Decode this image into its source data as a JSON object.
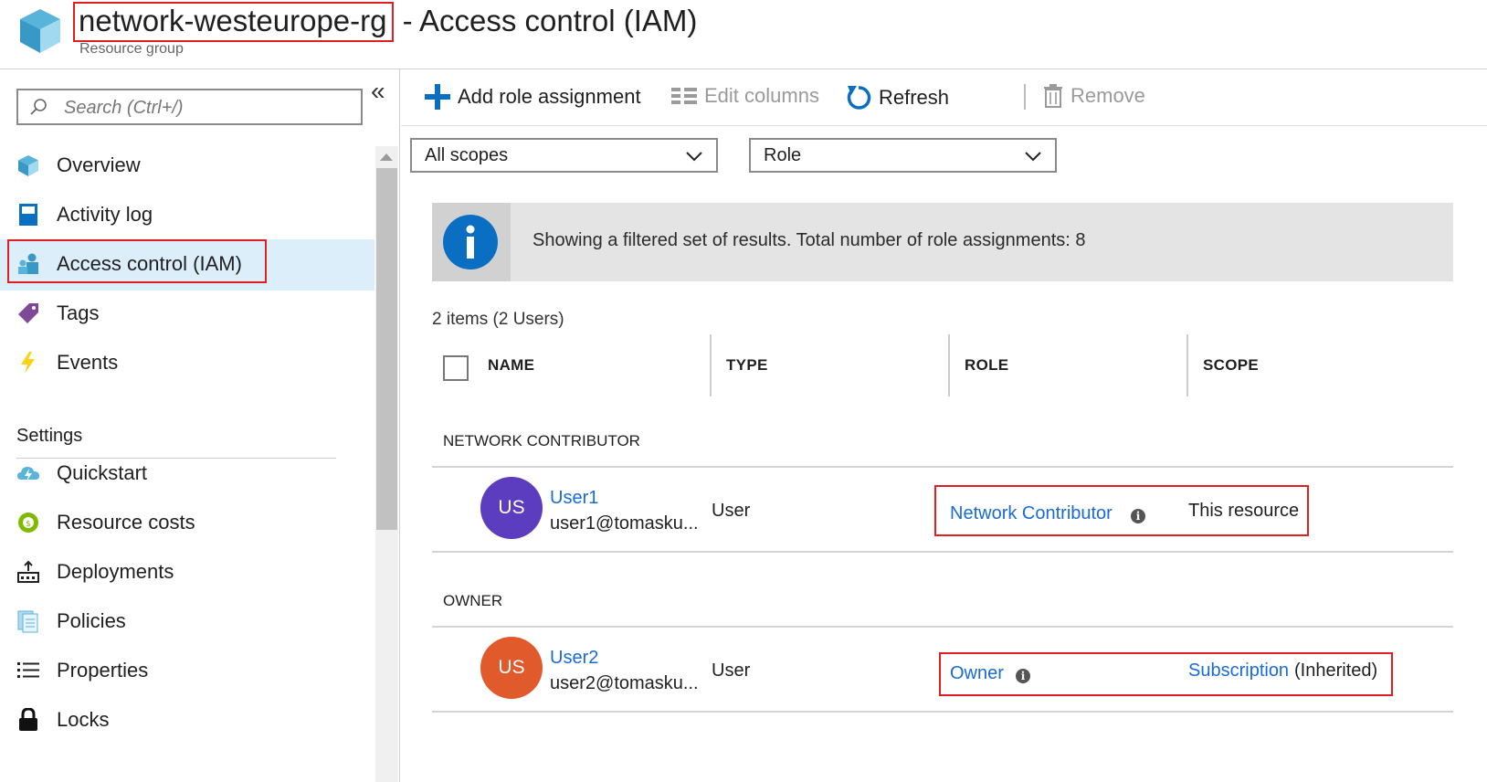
{
  "header": {
    "resource_name": "network-westeurope-rg",
    "title_rest": " - Access control (IAM)",
    "subtitle": "Resource group"
  },
  "sidebar": {
    "search_placeholder": "Search (Ctrl+/)",
    "collapse_glyph": "«",
    "items": [
      {
        "label": "Overview",
        "icon": "resource-group-icon"
      },
      {
        "label": "Activity log",
        "icon": "activity-log-icon"
      },
      {
        "label": "Access control (IAM)",
        "icon": "iam-icon",
        "active": true
      },
      {
        "label": "Tags",
        "icon": "tag-icon"
      },
      {
        "label": "Events",
        "icon": "lightning-icon"
      }
    ],
    "section_settings": "Settings",
    "settings_items": [
      {
        "label": "Quickstart",
        "icon": "cloud-icon"
      },
      {
        "label": "Resource costs",
        "icon": "cost-icon"
      },
      {
        "label": "Deployments",
        "icon": "deployments-icon"
      },
      {
        "label": "Policies",
        "icon": "policy-icon"
      },
      {
        "label": "Properties",
        "icon": "list-icon"
      },
      {
        "label": "Locks",
        "icon": "lock-icon"
      }
    ]
  },
  "toolbar": {
    "add_role": "Add role assignment",
    "edit_columns": "Edit columns",
    "refresh": "Refresh",
    "remove": "Remove"
  },
  "filters": {
    "scope_value": "All scopes",
    "group_value": "Role"
  },
  "info_banner": {
    "text": "Showing a filtered set of results. Total number of role assignments: 8"
  },
  "table": {
    "count": "2 items (2 Users)",
    "columns": [
      "NAME",
      "TYPE",
      "ROLE",
      "SCOPE"
    ],
    "groups": [
      {
        "title": "NETWORK CONTRIBUTOR",
        "rows": [
          {
            "initials": "US",
            "name": "User1",
            "email": "user1@tomasku...",
            "type": "User",
            "role": "Network Contributor",
            "scope": "This resource",
            "scope_suffix": ""
          }
        ]
      },
      {
        "title": "OWNER",
        "rows": [
          {
            "initials": "US",
            "name": "User2",
            "email": "user2@tomasku...",
            "type": "User",
            "role": "Owner",
            "scope": "Subscription",
            "scope_suffix": "(Inherited)"
          }
        ]
      }
    ]
  },
  "colors": {
    "accent": "#1a6bd6",
    "avatar_user1": "#5c3cbf",
    "avatar_user2": "#e05a2b",
    "highlight": "#e02020",
    "active_nav": "#ddeefb"
  }
}
